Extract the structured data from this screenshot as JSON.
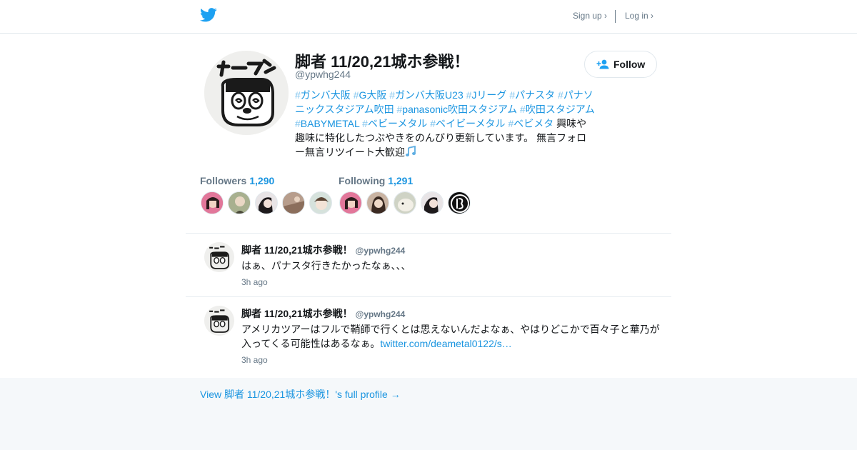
{
  "header": {
    "logo_icon": "twitter-bird-icon",
    "signup_label": "Sign up ›",
    "login_label": "Log in ›"
  },
  "profile": {
    "name": "脚者 11/20,21城ホ参戦！",
    "handle": "@ypwhg244",
    "follow_label": "Follow",
    "bio_tags": [
      "ガンバ大阪",
      "G大阪",
      "ガンバ大阪U23",
      "Jリーグ",
      "パナスタ",
      "パナソニックスタジアム吹田",
      "panasonic吹田スタジアム",
      "吹田スタジアム",
      "BABYMETAL",
      "ベビーメタル",
      "ベイビーメタル",
      "ベビメタ"
    ],
    "bio_text": " 興味や趣味に特化したつぶやきをのんびり更新しています。 無言フォロー無言リツイート大歓迎",
    "bio_emoji": "musical-note-icon"
  },
  "stats": {
    "followers_label": "Followers",
    "followers_count": "1,290",
    "following_label": "Following",
    "following_count": "1,291"
  },
  "tweets": [
    {
      "name": "脚者 11/20,21城ホ参戦！",
      "handle": "@ypwhg244",
      "text": "はぁ、パナスタ行きたかったなぁ、、、",
      "link": "",
      "time": "3h ago"
    },
    {
      "name": "脚者 11/20,21城ホ参戦！",
      "handle": "@ypwhg244",
      "text": "アメリカツアーはフルで鞘師で行くとは思えないんだよなぁ、やはりどこかで百々子と華乃が入ってくる可能性はあるなぁ。",
      "link": "twitter.com/deametal0122/s…",
      "time": "3h ago"
    }
  ],
  "footer": {
    "full_profile_link": "View 脚者 11/20,21城ホ参戦！'s full profile →"
  },
  "colors": {
    "accent": "#1b95e0",
    "muted": "#657786",
    "background": "#f5f8fa"
  }
}
